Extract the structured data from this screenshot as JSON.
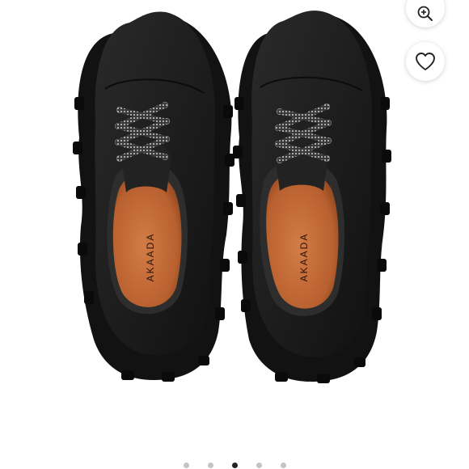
{
  "product": {
    "brand_print": "AKAADA",
    "colors": {
      "leather": "#1c1c1c",
      "sole": "#141414",
      "lining": "#c8703f",
      "background": "#ffffff"
    }
  },
  "controls": {
    "zoom_icon": "zoom-in-icon",
    "favorite_icon": "heart-outline-icon"
  },
  "carousel": {
    "total_slides": 5,
    "active_slide": 3
  }
}
